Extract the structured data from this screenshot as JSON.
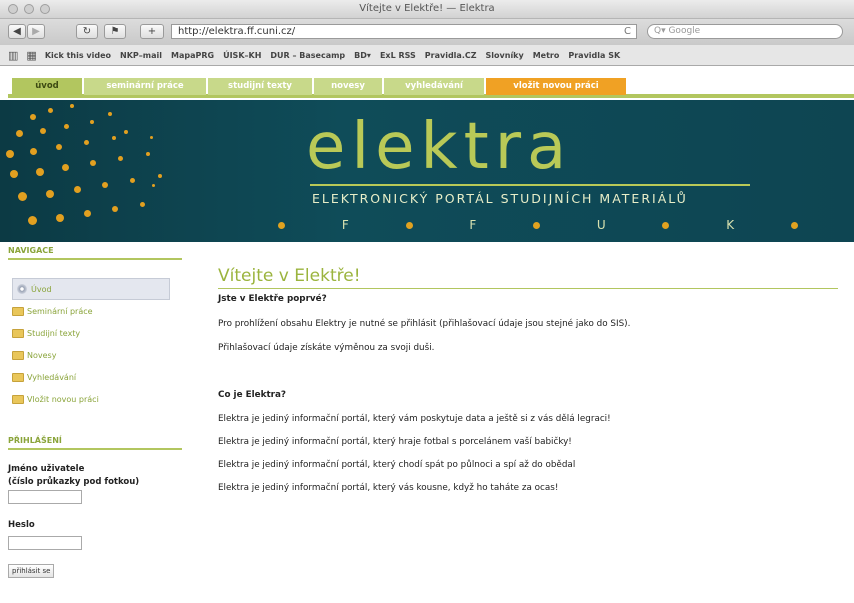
{
  "window": {
    "title": "Vítejte v Elektře! — Elektra"
  },
  "toolbar": {
    "back": "◀",
    "forward": "▶",
    "reload": "↻",
    "add": "+",
    "url": "http://elektra.ff.cuni.cz/",
    "url_reload": "C",
    "search_placeholder": "Q▾ Google"
  },
  "bookmarks": [
    "Kick this video",
    "NKP–mail",
    "MapaPRG",
    "ÚISK–KH",
    "DUR – Basecamp",
    "BD▾",
    "ExL RSS",
    "Pravidla.CZ",
    "Slovníky",
    "Metro",
    "Pravidla SK"
  ],
  "tabs": [
    {
      "label": "úvod",
      "bg": "#b2c65f",
      "fg": "#3d4a12"
    },
    {
      "label": "seminární práce",
      "bg": "#c8d98a",
      "fg": "#ffffff"
    },
    {
      "label": "studijní texty",
      "bg": "#c8d98a",
      "fg": "#ffffff"
    },
    {
      "label": "novesy",
      "bg": "#c8d98a",
      "fg": "#ffffff"
    },
    {
      "label": "vyhledávání",
      "bg": "#c8d98a",
      "fg": "#ffffff"
    },
    {
      "label": "vložit novou práci",
      "bg": "#f0a124",
      "fg": "#ffffff"
    }
  ],
  "banner": {
    "logo": "elektra",
    "subtitle": "ELEKTRONICKÝ PORTÁL STUDIJNÍCH MATERIÁLŮ",
    "letters": [
      "F",
      "F",
      "U",
      "K"
    ]
  },
  "sidebar": {
    "nav_heading": "NAVIGACE",
    "items": [
      "Úvod",
      "Seminární práce",
      "Studijní texty",
      "Novesy",
      "Vyhledávání",
      "Vložit novou práci"
    ],
    "login_heading": "PŘIHLÁŠENÍ",
    "username_label": "Jméno uživatele",
    "username_hint": "(číslo průkazky pod fotkou)",
    "password_label": "Heslo",
    "login_button": "přihlásit se"
  },
  "main": {
    "title": "Vítejte v Elektře!",
    "first_time_heading": "Jste v Elektře poprvé?",
    "p1": "Pro prohlížení obsahu Elektry je nutné se přihlásit (přihlašovací údaje jsou stejné jako do SIS).",
    "p2": "Přihlašovací údaje získáte výměnou za svoji duši.",
    "what_heading": "Co je Elektra?",
    "lines": [
      "Elektra je jediný informační portál, který vám poskytuje data a ještě si z vás dělá legraci!",
      "Elektra je jediný informační portál, který hraje fotbal s porcelánem vaší babičky!",
      "Elektra je jediný informační portál, který chodí spát po půlnoci a spí až do obědal",
      "Elektra je jediný informační portál, který vás kousne, když ho taháte za ocas!"
    ]
  }
}
